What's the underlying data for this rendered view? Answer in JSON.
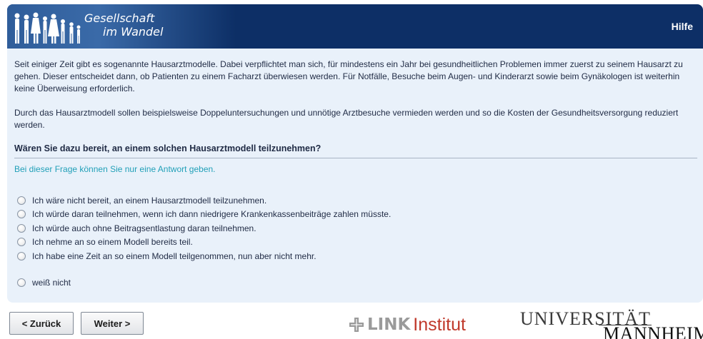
{
  "header": {
    "logo_line1": "Gesellschaft",
    "logo_line2": "im Wandel",
    "help_label": "Hilfe"
  },
  "intro": {
    "paragraph1": "Seit einiger Zeit gibt es sogenannte Hausarztmodelle. Dabei verpflichtet man sich, für mindestens ein Jahr bei gesundheitlichen Problemen immer zuerst zu seinem Hausarzt zu gehen. Dieser entscheidet dann, ob Patienten zu einem Facharzt überwiesen werden. Für Notfälle, Besuche beim Augen- und Kinderarzt sowie beim Gynäkologen ist weiterhin keine Überweisung erforderlich.",
    "paragraph2": "Durch das Hausarztmodell sollen beispielsweise Doppeluntersuchungen und unnötige Arztbesuche vermieden werden und so die Kosten der Gesundheitsversorgung reduziert werden."
  },
  "question": {
    "text": "Wären Sie dazu bereit, an einem solchen Hausarztmodell teilzunehmen?",
    "hint": "Bei dieser Frage können Sie nur eine Antwort geben.",
    "options": [
      "Ich wäre nicht bereit, an einem Hausarztmodell teilzunehmen.",
      "Ich würde daran teilnehmen, wenn ich dann niedrigere Krankenkassenbeiträge zahlen müsste.",
      "Ich würde auch ohne Beitragsentlastung daran teilnehmen.",
      "Ich nehme an so einem Modell bereits teil.",
      "Ich habe eine Zeit an so einem Modell teilgenommen, nun aber nicht mehr."
    ],
    "dont_know": "weiß nicht",
    "selected": null
  },
  "nav": {
    "back_label": "< Zurück",
    "next_label": "Weiter >"
  },
  "branding": {
    "link_word": "LINK",
    "link_institut": "Institut",
    "uni_top": "UNIVERSITÄT",
    "uni_bottom": "MANNHEIM"
  },
  "colors": {
    "header_bg": "#0d2f66",
    "panel_bg": "#e9f1fa",
    "hint": "#21a0b8",
    "link_red": "#c0392b"
  }
}
